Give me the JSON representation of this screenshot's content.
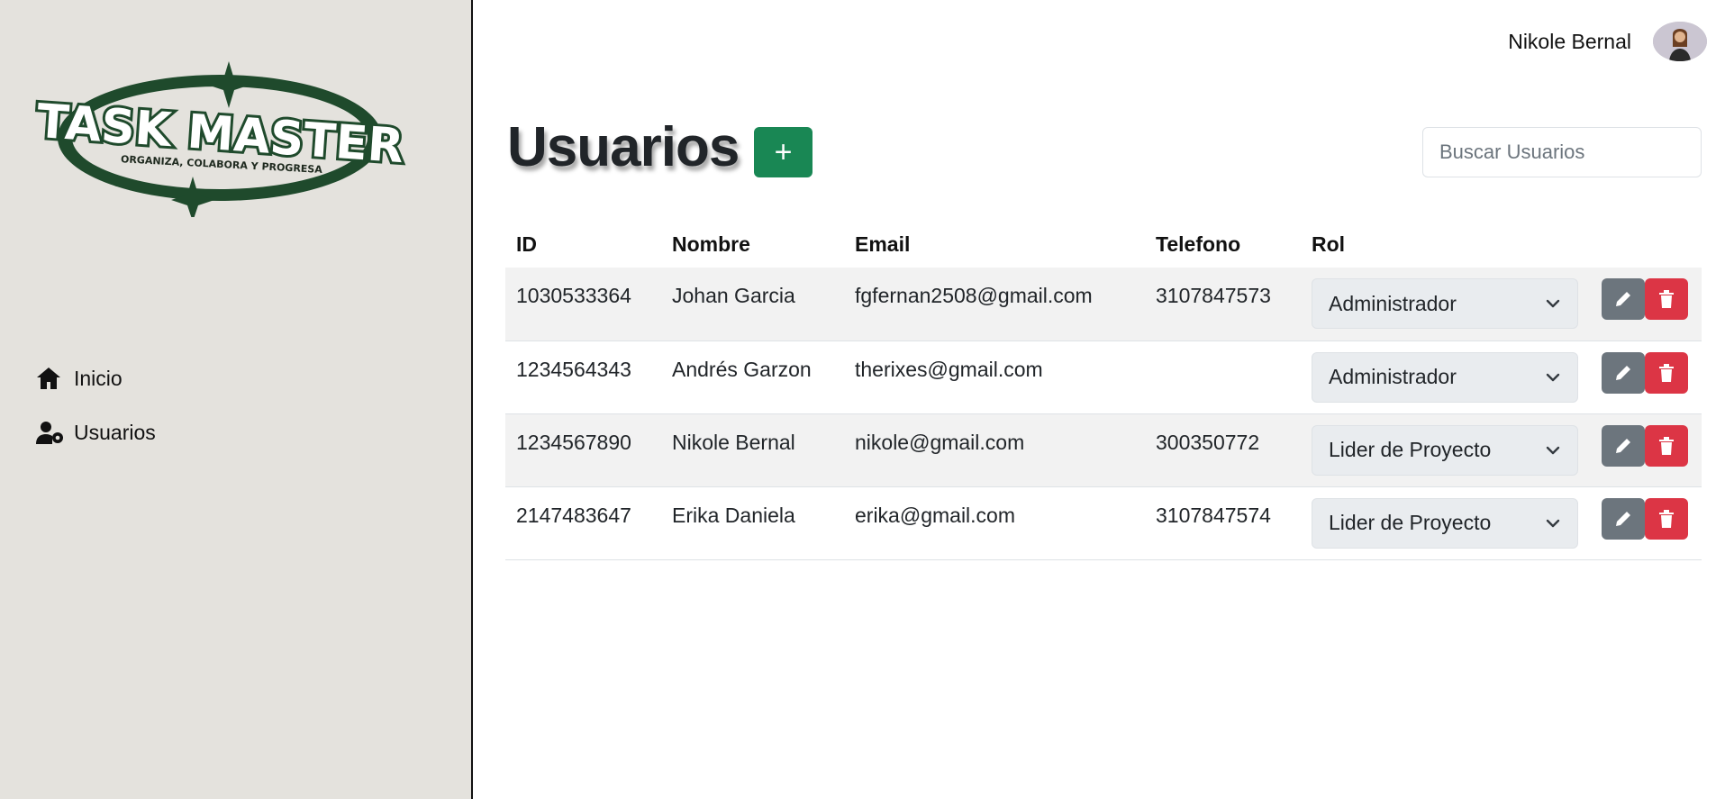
{
  "logo": {
    "main_text": "TASK MASTER",
    "tagline": "ORGANIZA, COLABORA Y PROGRESA"
  },
  "sidebar": {
    "items": [
      {
        "label": "Inicio",
        "icon": "home-icon"
      },
      {
        "label": "Usuarios",
        "icon": "user-gear-icon"
      }
    ]
  },
  "header": {
    "user_name": "Nikole Bernal"
  },
  "page": {
    "title": "Usuarios",
    "add_label": "+",
    "search_placeholder": "Buscar Usuarios"
  },
  "table": {
    "columns": [
      "ID",
      "Nombre",
      "Email",
      "Telefono",
      "Rol"
    ],
    "rows": [
      {
        "id": "1030533364",
        "name": "Johan Garcia",
        "email": "fgfernan2508@gmail.com",
        "phone": "3107847573",
        "role": "Administrador"
      },
      {
        "id": "1234564343",
        "name": "Andrés Garzon",
        "email": "therixes@gmail.com",
        "phone": "",
        "role": "Administrador"
      },
      {
        "id": "1234567890",
        "name": "Nikole Bernal",
        "email": "nikole@gmail.com",
        "phone": "300350772",
        "role": "Lider de Proyecto"
      },
      {
        "id": "2147483647",
        "name": "Erika Daniela",
        "email": "erika@gmail.com",
        "phone": "3107847574",
        "role": "Lider de Proyecto"
      }
    ]
  },
  "colors": {
    "sidebar_bg": "#e4e2dd",
    "logo_green": "#1f4a2c",
    "add_green": "#198754",
    "edit_gray": "#6c757d",
    "delete_red": "#dc3545"
  }
}
